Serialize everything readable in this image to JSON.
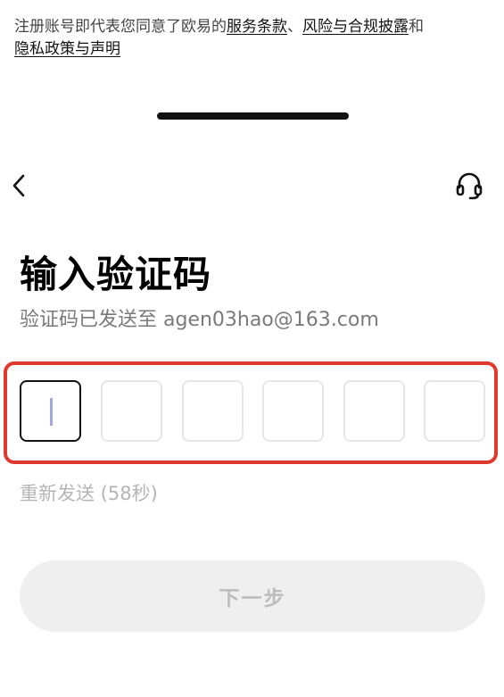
{
  "terms": {
    "prefix": "注册账号即代表您同意了欧易的",
    "link_terms": "服务条款",
    "separator": "、",
    "link_risk": "风险与合规披露",
    "joiner": "和",
    "link_privacy": "隐私政策与声明"
  },
  "header": {
    "back_icon": "chevron-left",
    "support_icon": "headset"
  },
  "verification": {
    "title": "输入验证码",
    "sent_notice": "验证码已发送至 agen03hao@163.com",
    "code_digits": [
      "",
      "",
      "",
      "",
      "",
      ""
    ],
    "active_index": 0,
    "resend_label": "重新发送 (58秒)"
  },
  "actions": {
    "next_label": "下一步"
  },
  "colors": {
    "highlight": "#e03a2f",
    "caret": "#9fa8dc",
    "disabled_text": "#bdbdbd",
    "disabled_bg": "#efefef"
  }
}
